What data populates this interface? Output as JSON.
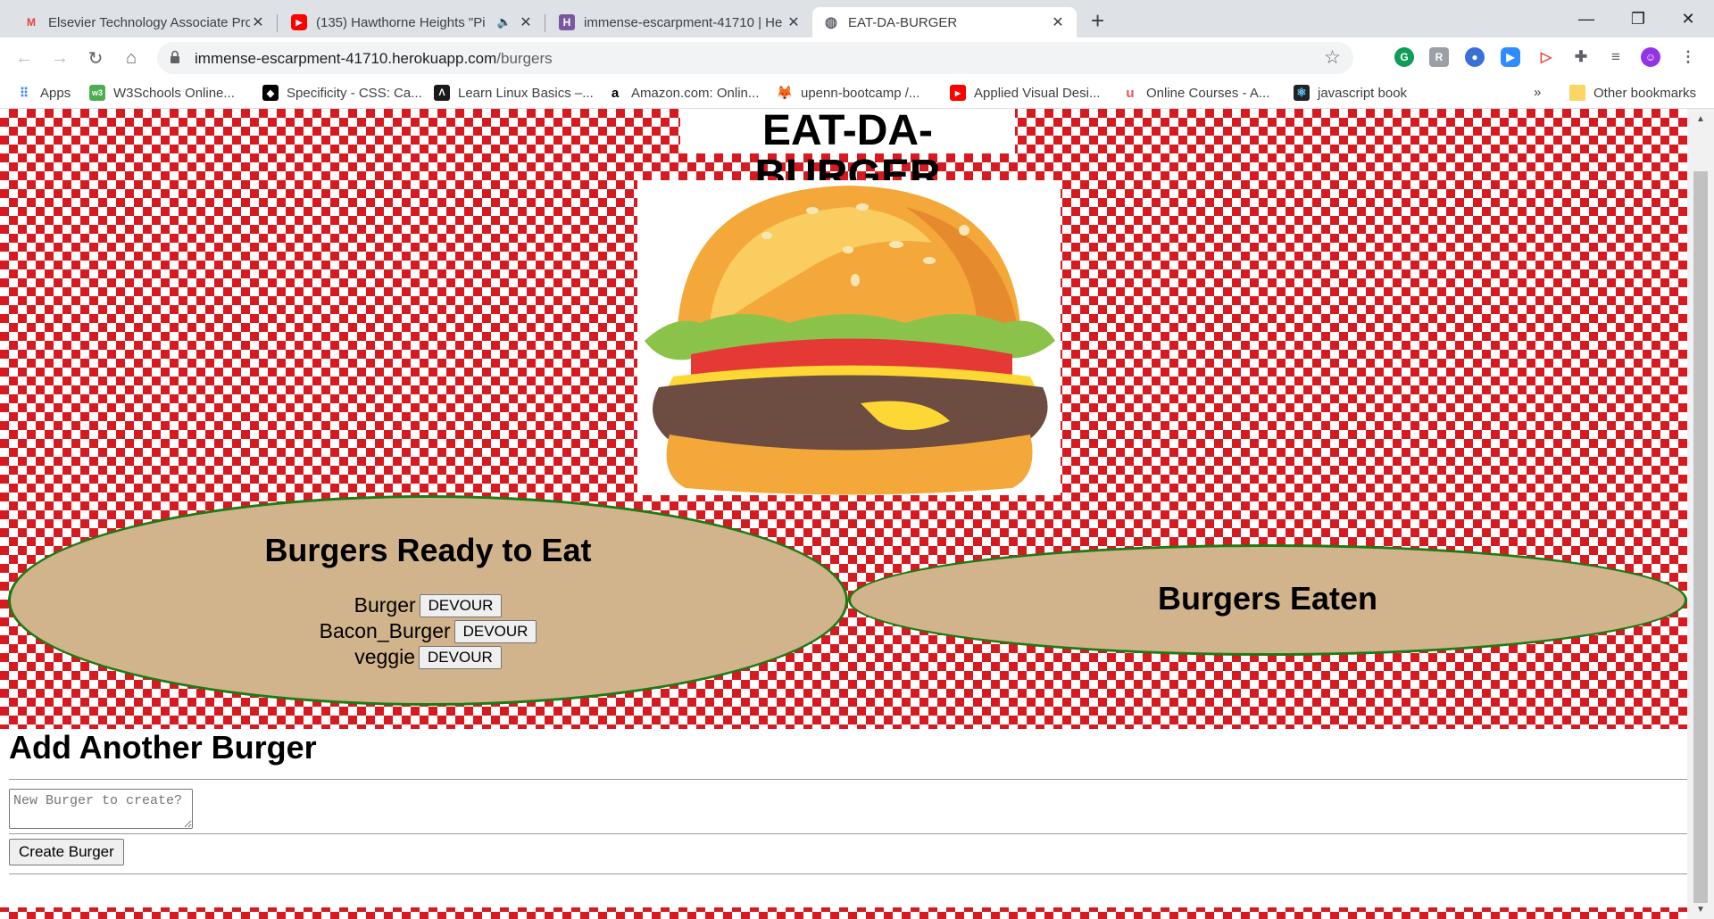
{
  "browser": {
    "tabs": [
      {
        "title": "Elsevier Technology Associate Pro",
        "icon": "gmail-icon",
        "active": false
      },
      {
        "title": "(135) Hawthorne Heights \"Pi",
        "icon": "youtube-icon",
        "active": false
      },
      {
        "title": "immense-escarpment-41710 | He",
        "icon": "heroku-icon",
        "active": false
      },
      {
        "title": "EAT-DA-BURGER",
        "icon": "globe-icon",
        "active": true
      }
    ],
    "new_tab": "+",
    "address": {
      "host": "immense-escarpment-41710.herokuapp.com",
      "path": "/burgers"
    },
    "bookmarks": [
      {
        "label": "Apps",
        "icon": "apps-icon"
      },
      {
        "label": "W3Schools Online...",
        "icon": "w3schools-icon"
      },
      {
        "label": "Specificity - CSS: Ca...",
        "icon": "mdn-icon"
      },
      {
        "label": "Learn Linux Basics –...",
        "icon": "linux-icon"
      },
      {
        "label": "Amazon.com: Onlin...",
        "icon": "amazon-icon"
      },
      {
        "label": "upenn-bootcamp /...",
        "icon": "gitlab-icon"
      },
      {
        "label": "Applied Visual Desi...",
        "icon": "youtube-icon"
      },
      {
        "label": "Online Courses - A...",
        "icon": "udemy-icon"
      },
      {
        "label": "javascript book",
        "icon": "react-icon"
      }
    ],
    "bookmarks_overflow": "»",
    "other_bookmarks": "Other bookmarks"
  },
  "page": {
    "title": "EAT-DA-BURGER",
    "ready_heading": "Burgers Ready to Eat",
    "ready_burgers": [
      {
        "name": "Burger",
        "button": "DEVOUR"
      },
      {
        "name": "Bacon_Burger",
        "button": "DEVOUR"
      },
      {
        "name": "veggie",
        "button": "DEVOUR"
      }
    ],
    "eaten_heading": "Burgers Eaten",
    "eaten_burgers": [],
    "form": {
      "heading": "Add Another Burger",
      "placeholder": "New Burger to create?",
      "submit": "Create Burger"
    }
  },
  "colors": {
    "checker_red": "#d71920",
    "oval_fill": "#d2b48c",
    "oval_border": "#1e7a14"
  }
}
